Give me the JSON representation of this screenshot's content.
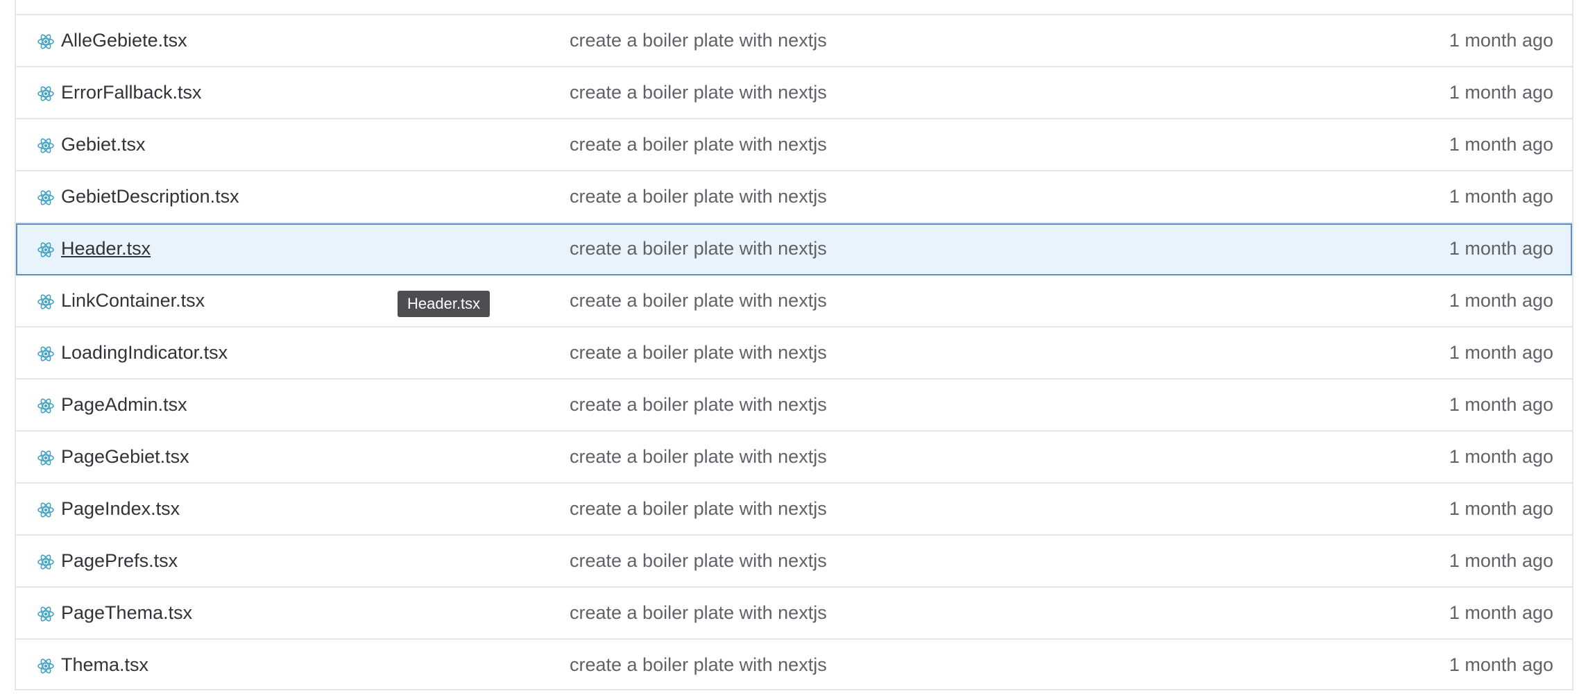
{
  "accent_color": "#5c8fc6",
  "icon_color": "#41a2c2",
  "file_icon": "react-icon",
  "files": [
    {
      "name": "AlleGebiete.tsx",
      "commit": "create a boiler plate with nextjs",
      "time": "1 month ago"
    },
    {
      "name": "ErrorFallback.tsx",
      "commit": "create a boiler plate with nextjs",
      "time": "1 month ago"
    },
    {
      "name": "Gebiet.tsx",
      "commit": "create a boiler plate with nextjs",
      "time": "1 month ago"
    },
    {
      "name": "GebietDescription.tsx",
      "commit": "create a boiler plate with nextjs",
      "time": "1 month ago"
    },
    {
      "name": "Header.tsx",
      "commit": "create a boiler plate with nextjs",
      "time": "1 month ago"
    },
    {
      "name": "LinkContainer.tsx",
      "commit": "create a boiler plate with nextjs",
      "time": "1 month ago"
    },
    {
      "name": "LoadingIndicator.tsx",
      "commit": "create a boiler plate with nextjs",
      "time": "1 month ago"
    },
    {
      "name": "PageAdmin.tsx",
      "commit": "create a boiler plate with nextjs",
      "time": "1 month ago"
    },
    {
      "name": "PageGebiet.tsx",
      "commit": "create a boiler plate with nextjs",
      "time": "1 month ago"
    },
    {
      "name": "PageIndex.tsx",
      "commit": "create a boiler plate with nextjs",
      "time": "1 month ago"
    },
    {
      "name": "PagePrefs.tsx",
      "commit": "create a boiler plate with nextjs",
      "time": "1 month ago"
    },
    {
      "name": "PageThema.tsx",
      "commit": "create a boiler plate with nextjs",
      "time": "1 month ago"
    },
    {
      "name": "Thema.tsx",
      "commit": "create a boiler plate with nextjs",
      "time": "1 month ago"
    }
  ],
  "hovered_index": 4,
  "tooltip": {
    "text": "Header.tsx"
  }
}
